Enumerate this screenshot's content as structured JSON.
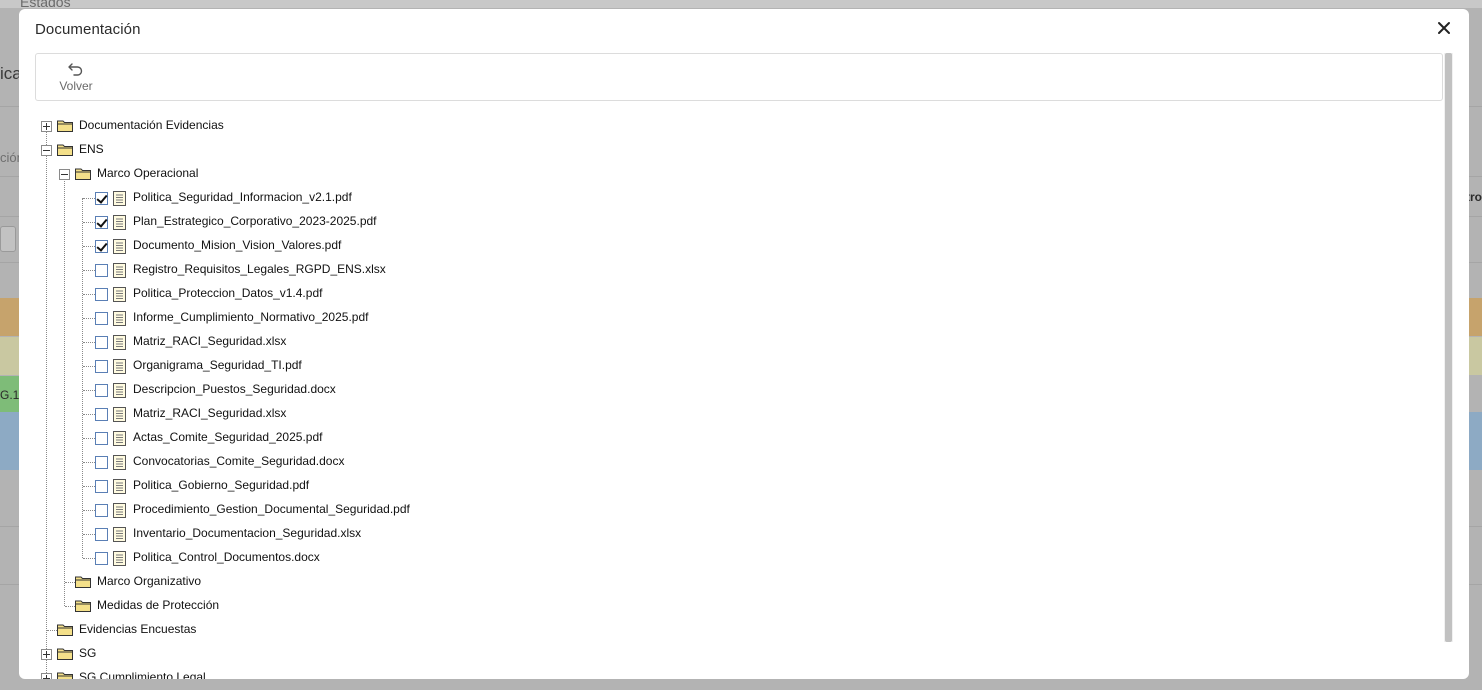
{
  "background": {
    "breadcrumb": "Estados",
    "fragment_left": "ica",
    "fragment_mid": "ción",
    "fragment_right": "tro",
    "row_code": "G.1"
  },
  "modal": {
    "title": "Documentación",
    "close_icon": "close-icon",
    "toolbar": {
      "back_label": "Volver",
      "back_icon": "undo-arrow-icon"
    }
  },
  "tree": {
    "folders": {
      "documentacion_evidencias": "Documentación Evidencias",
      "ens": "ENS",
      "marco_operacional": "Marco Operacional",
      "marco_organizativo": "Marco Organizativo",
      "medidas_proteccion": "Medidas de Protección",
      "evidencias_encuestas": "Evidencias Encuestas",
      "sg": "SG",
      "sg_cumplimiento_legal": "SG Cumplimiento Legal"
    },
    "files": [
      {
        "name": "Politica_Seguridad_Informacion_v2.1.pdf",
        "checked": true
      },
      {
        "name": "Plan_Estrategico_Corporativo_2023-2025.pdf",
        "checked": true
      },
      {
        "name": "Documento_Mision_Vision_Valores.pdf",
        "checked": true
      },
      {
        "name": "Registro_Requisitos_Legales_RGPD_ENS.xlsx",
        "checked": false
      },
      {
        "name": "Politica_Proteccion_Datos_v1.4.pdf",
        "checked": false
      },
      {
        "name": "Informe_Cumplimiento_Normativo_2025.pdf",
        "checked": false
      },
      {
        "name": "Matriz_RACI_Seguridad.xlsx",
        "checked": false
      },
      {
        "name": "Organigrama_Seguridad_TI.pdf",
        "checked": false
      },
      {
        "name": "Descripcion_Puestos_Seguridad.docx",
        "checked": false
      },
      {
        "name": "Matriz_RACI_Seguridad.xlsx",
        "checked": false
      },
      {
        "name": "Actas_Comite_Seguridad_2025.pdf",
        "checked": false
      },
      {
        "name": "Convocatorias_Comite_Seguridad.docx",
        "checked": false
      },
      {
        "name": "Politica_Gobierno_Seguridad.pdf",
        "checked": false
      },
      {
        "name": "Procedimiento_Gestion_Documental_Seguridad.pdf",
        "checked": false
      },
      {
        "name": "Inventario_Documentacion_Seguridad.xlsx",
        "checked": false
      },
      {
        "name": "Politica_Control_Documentos.docx",
        "checked": false
      }
    ]
  }
}
